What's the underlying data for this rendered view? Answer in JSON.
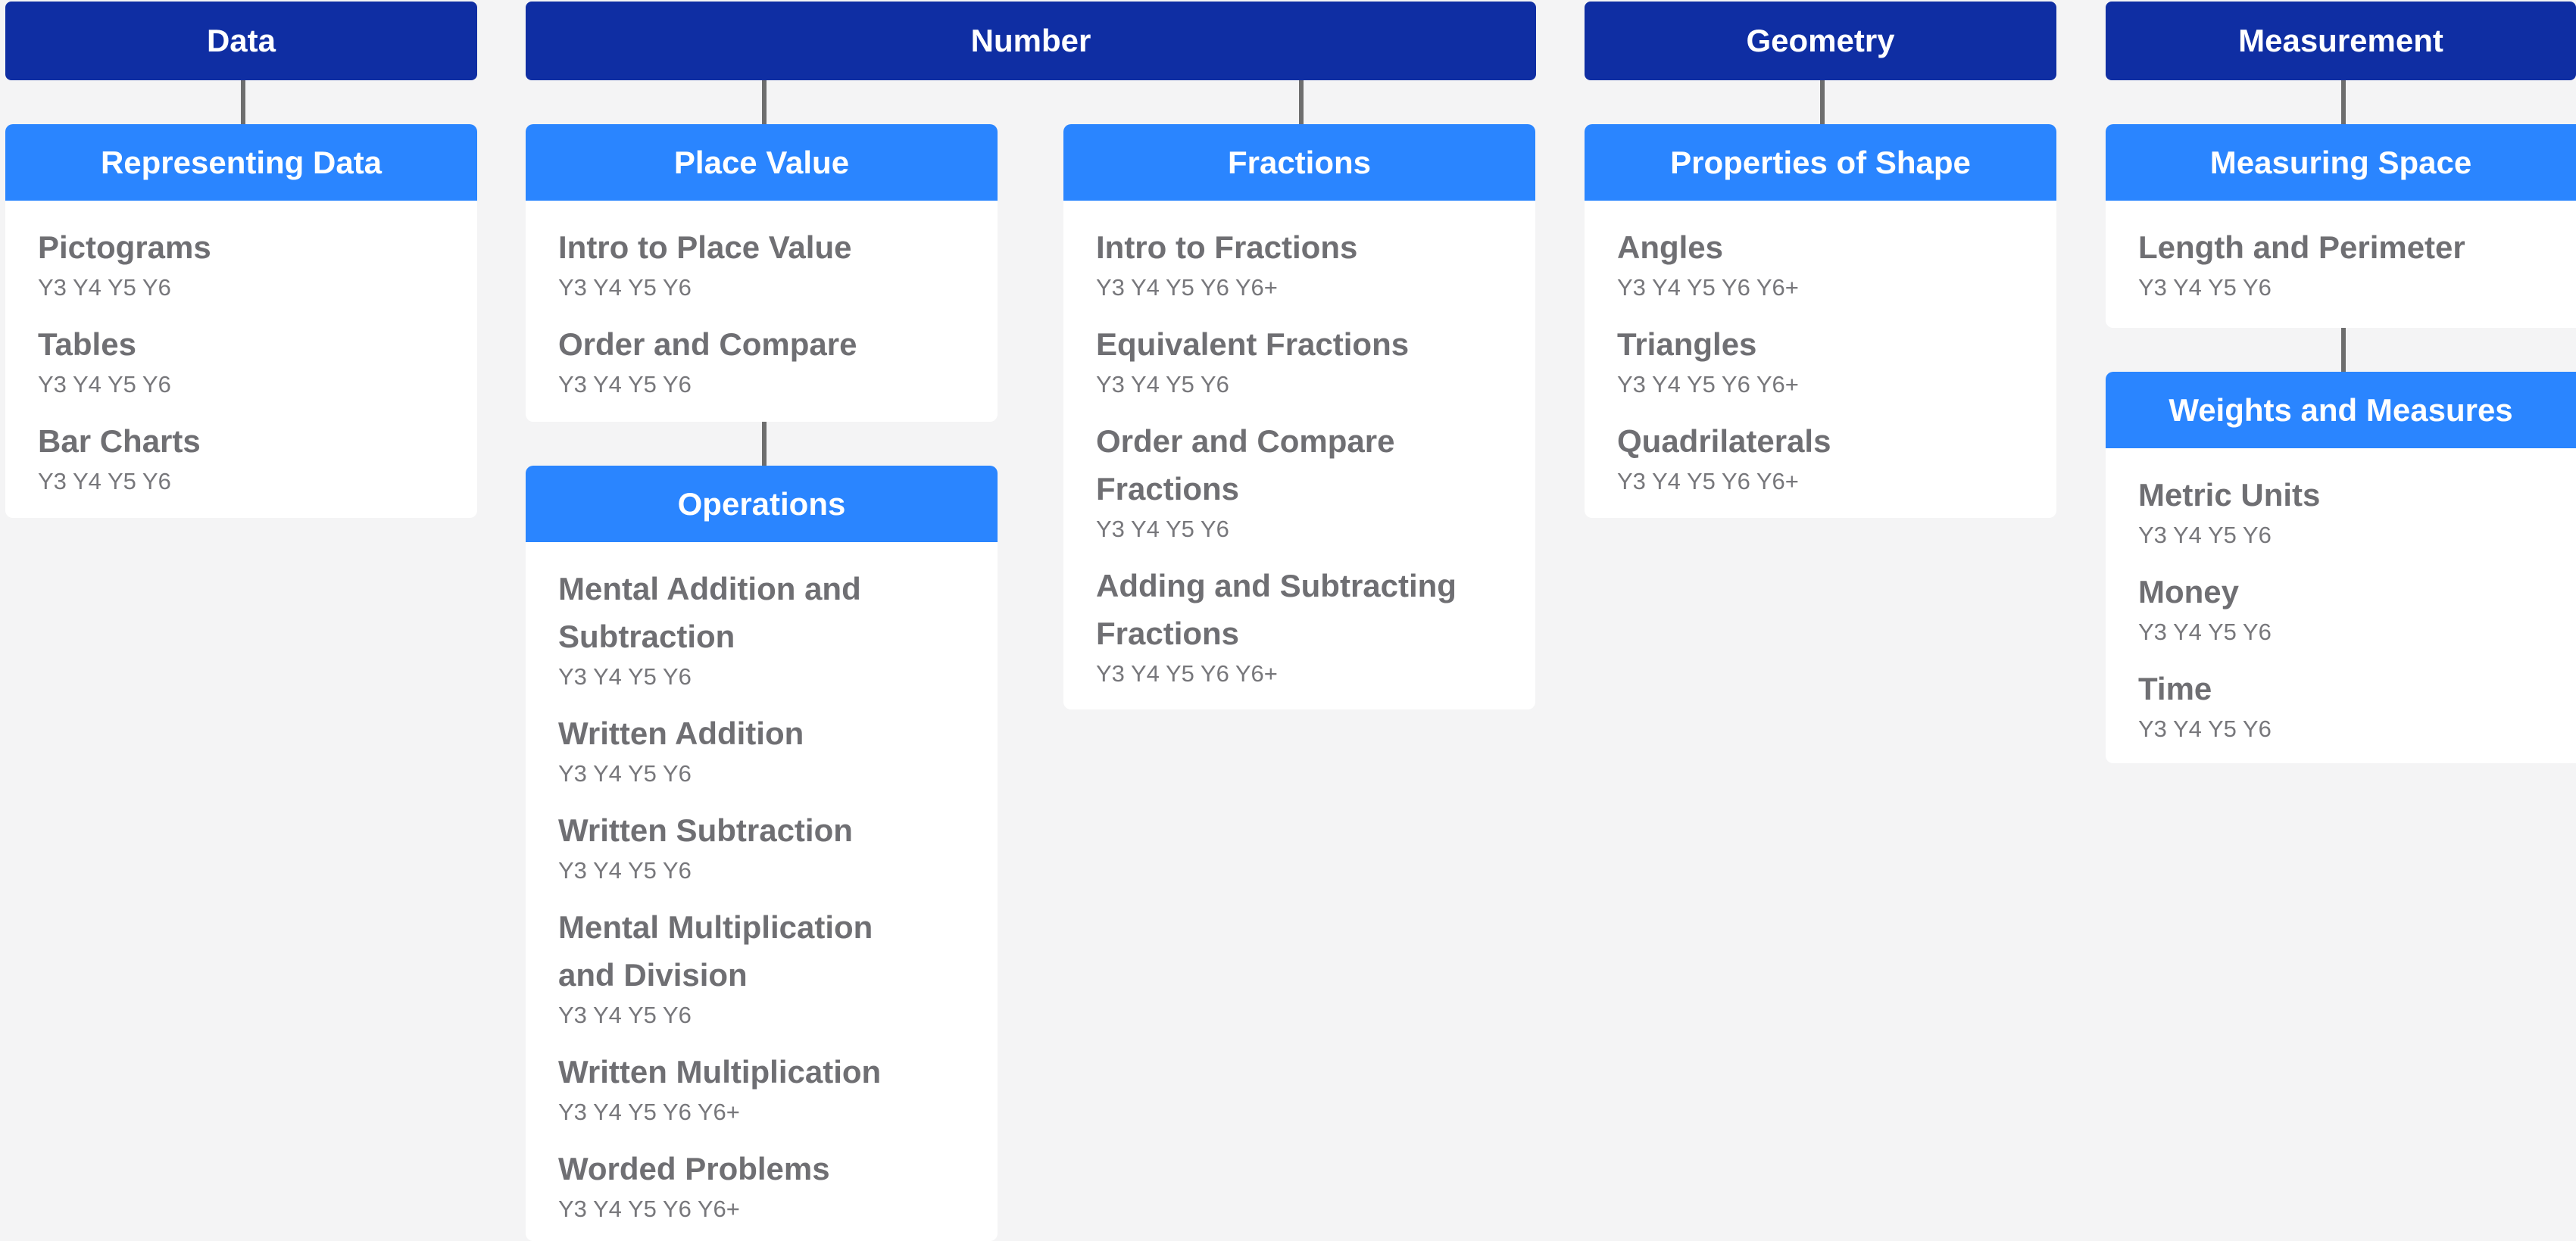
{
  "topics": {
    "data": "Data",
    "number": "Number",
    "geometry": "Geometry",
    "measurement": "Measurement"
  },
  "units": {
    "representing_data": {
      "label": "Representing Data",
      "lessons": [
        {
          "title": "Pictograms",
          "years": "Y3 Y4 Y5 Y6"
        },
        {
          "title": "Tables",
          "years": "Y3 Y4 Y5 Y6"
        },
        {
          "title": "Bar Charts",
          "years": "Y3 Y4 Y5 Y6"
        }
      ]
    },
    "place_value": {
      "label": "Place Value",
      "lessons": [
        {
          "title": "Intro to Place Value",
          "years": "Y3 Y4 Y5 Y6"
        },
        {
          "title": "Order and Compare",
          "years": "Y3 Y4 Y5 Y6"
        }
      ]
    },
    "operations": {
      "label": "Operations",
      "lessons": [
        {
          "title": "Mental Addition and Subtraction",
          "years": "Y3 Y4 Y5 Y6"
        },
        {
          "title": "Written Addition",
          "years": "Y3 Y4 Y5 Y6"
        },
        {
          "title": "Written Subtraction",
          "years": "Y3 Y4 Y5 Y6"
        },
        {
          "title": "Mental Multiplication and Division",
          "years": "Y3 Y4 Y5 Y6"
        },
        {
          "title": "Written Multiplication",
          "years": "Y3 Y4 Y5 Y6 Y6+"
        },
        {
          "title": "Worded Problems",
          "years": "Y3 Y4 Y5 Y6 Y6+"
        }
      ]
    },
    "fractions": {
      "label": "Fractions",
      "lessons": [
        {
          "title": "Intro to Fractions",
          "years": "Y3 Y4 Y5 Y6 Y6+"
        },
        {
          "title": "Equivalent Fractions",
          "years": "Y3 Y4 Y5 Y6"
        },
        {
          "title": "Order and Compare Fractions",
          "years": "Y3 Y4 Y5 Y6"
        },
        {
          "title": "Adding and Subtracting Fractions",
          "years": "Y3 Y4 Y5 Y6 Y6+"
        }
      ]
    },
    "properties_of_shape": {
      "label": "Properties of Shape",
      "lessons": [
        {
          "title": "Angles",
          "years": "Y3 Y4 Y5 Y6 Y6+"
        },
        {
          "title": "Triangles",
          "years": "Y3 Y4 Y5 Y6 Y6+"
        },
        {
          "title": "Quadrilaterals",
          "years": "Y3 Y4 Y5 Y6 Y6+"
        }
      ]
    },
    "measuring_space": {
      "label": "Measuring Space",
      "lessons": [
        {
          "title": "Length and Perimeter",
          "years": "Y3 Y4 Y5 Y6"
        }
      ]
    },
    "weights_and_measures": {
      "label": "Weights and Measures",
      "lessons": [
        {
          "title": "Metric Units",
          "years": "Y3 Y4 Y5 Y6"
        },
        {
          "title": "Money",
          "years": "Y3 Y4 Y5 Y6"
        },
        {
          "title": "Time",
          "years": "Y3 Y4 Y5 Y6"
        }
      ]
    }
  },
  "colors": {
    "topic_bg": "#0f2ea3",
    "unit_header_bg": "#2a85ff",
    "connector": "#6e6e6e",
    "lesson_text": "#6f6f73",
    "page_bg": "#f4f4f5"
  }
}
